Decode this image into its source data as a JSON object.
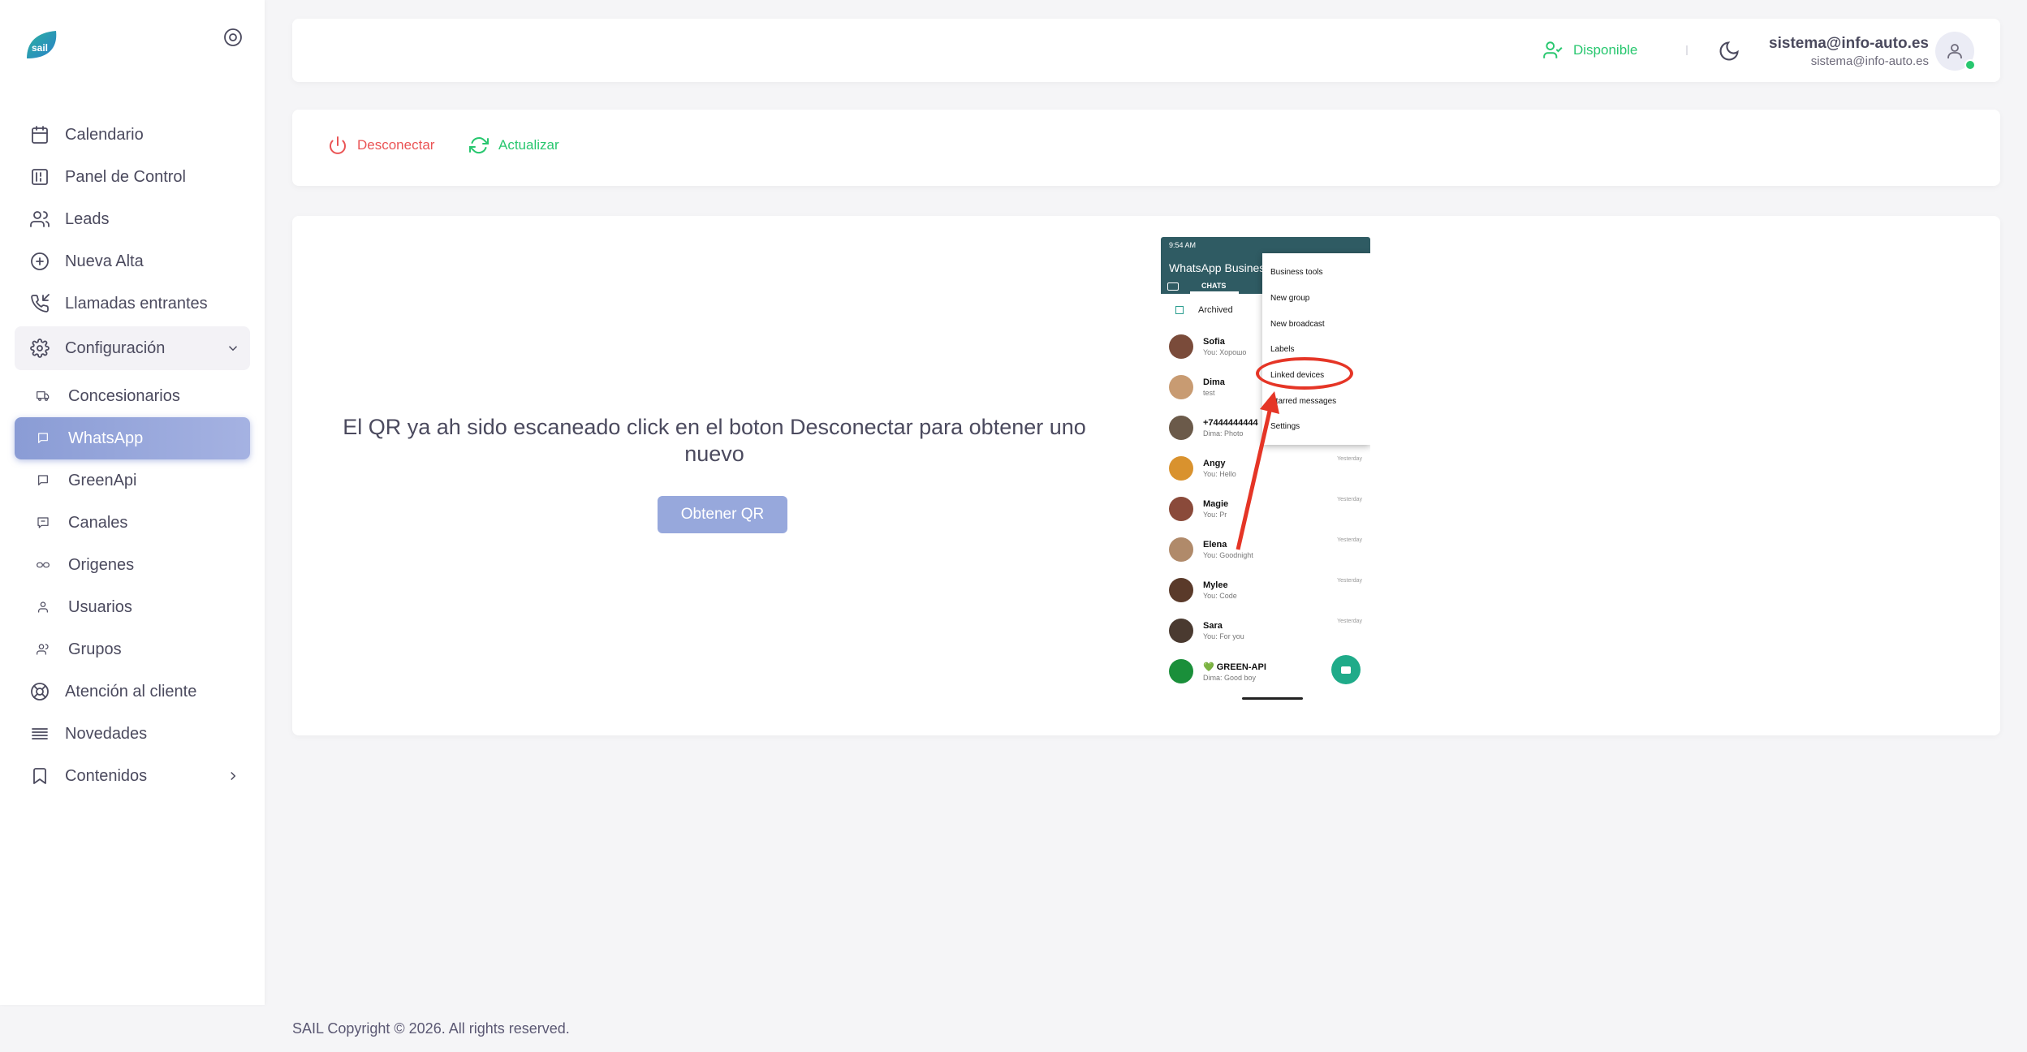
{
  "sidebar": {
    "logo_text": "sail",
    "items": [
      {
        "label": "Calendario",
        "icon": "calendar-icon"
      },
      {
        "label": "Panel de Control",
        "icon": "dashboard-icon"
      },
      {
        "label": "Leads",
        "icon": "users-icon"
      },
      {
        "label": "Nueva Alta",
        "icon": "plus-circle-icon"
      },
      {
        "label": "Llamadas entrantes",
        "icon": "phone-incoming-icon"
      }
    ],
    "group": {
      "label": "Configuración",
      "icon": "gear-icon"
    },
    "sub_items": [
      {
        "label": "Concesionarios",
        "icon": "truck-icon"
      },
      {
        "label": "WhatsApp",
        "icon": "message-icon",
        "active": true
      },
      {
        "label": "GreenApi",
        "icon": "message-icon"
      },
      {
        "label": "Canales",
        "icon": "message-square-icon"
      },
      {
        "label": "Origenes",
        "icon": "link-icon"
      },
      {
        "label": "Usuarios",
        "icon": "user-icon"
      },
      {
        "label": "Grupos",
        "icon": "users-icon"
      }
    ],
    "bottom_items": [
      {
        "label": "Atención al cliente",
        "icon": "lifebuoy-icon"
      },
      {
        "label": "Novedades",
        "icon": "list-icon"
      },
      {
        "label": "Contenidos",
        "icon": "bookmark-icon"
      }
    ]
  },
  "topbar": {
    "status": "Disponible",
    "user_name": "sistema@info-auto.es",
    "user_email": "sistema@info-auto.es"
  },
  "actions": {
    "disconnect": "Desconectar",
    "refresh": "Actualizar"
  },
  "main": {
    "message": "El QR ya ah sido escaneado click en el boton Desconectar para obtener uno nuevo",
    "qr_button": "Obtener QR"
  },
  "phone": {
    "status_time": "9:54 AM",
    "title": "WhatsApp Business",
    "tab": "CHATS",
    "archived": "Archived",
    "menu": [
      "Business tools",
      "New group",
      "New broadcast",
      "Labels",
      "Linked devices",
      "Starred messages",
      "Settings"
    ],
    "chats": [
      {
        "name": "Sofia",
        "last": "You: Хорошо",
        "time": "",
        "color": "#7a4b3a"
      },
      {
        "name": "Dima",
        "last": "test",
        "time": "",
        "color": "#c89b72"
      },
      {
        "name": "+7444444444",
        "last": "Dima: Photo",
        "time": "",
        "color": "#6b5a4a"
      },
      {
        "name": "Angy",
        "last": "You: Hello",
        "time": "Yesterday",
        "color": "#d9922e"
      },
      {
        "name": "Magie",
        "last": "You: Pr",
        "time": "Yesterday",
        "color": "#8a4a3a"
      },
      {
        "name": "Elena",
        "last": "You: Goodnight",
        "time": "Yesterday",
        "color": "#b08a6a"
      },
      {
        "name": "Mylee",
        "last": "You: Code",
        "time": "Yesterday",
        "color": "#5a3a2a"
      },
      {
        "name": "Sara",
        "last": "You: For you",
        "time": "Yesterday",
        "color": "#4a3a30"
      },
      {
        "name": "💚 GREEN-API",
        "last": "Dima: Good boy",
        "time": "",
        "color": "#1a8f3a"
      }
    ]
  },
  "footer": "SAIL Copyright © 2026. All rights reserved."
}
